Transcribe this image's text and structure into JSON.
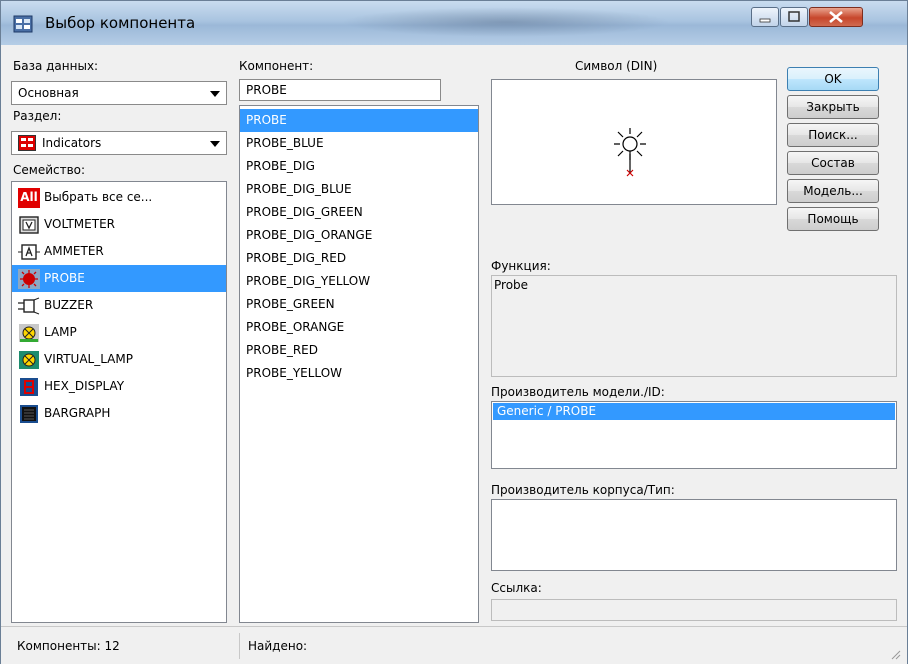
{
  "window": {
    "title": "Выбор компонента"
  },
  "database": {
    "label": "База данных:",
    "value": "Основная"
  },
  "section": {
    "label": "Раздел:",
    "value": "Indicators"
  },
  "family": {
    "label": "Семейство:",
    "items": [
      {
        "label": "Выбрать все се...",
        "icon": "all-icon"
      },
      {
        "label": "VOLTMETER",
        "icon": "voltmeter-icon"
      },
      {
        "label": "AMMETER",
        "icon": "ammeter-icon"
      },
      {
        "label": "PROBE",
        "icon": "probe-icon"
      },
      {
        "label": "BUZZER",
        "icon": "buzzer-icon"
      },
      {
        "label": "LAMP",
        "icon": "lamp-icon"
      },
      {
        "label": "VIRTUAL_LAMP",
        "icon": "virtual-lamp-icon"
      },
      {
        "label": "HEX_DISPLAY",
        "icon": "hex-display-icon"
      },
      {
        "label": "BARGRAPH",
        "icon": "bargraph-icon"
      }
    ],
    "selected": "PROBE",
    "all_badge": "All"
  },
  "component": {
    "label": "Компонент:",
    "value": "PROBE",
    "items": [
      "PROBE",
      "PROBE_BLUE",
      "PROBE_DIG",
      "PROBE_DIG_BLUE",
      "PROBE_DIG_GREEN",
      "PROBE_DIG_ORANGE",
      "PROBE_DIG_RED",
      "PROBE_DIG_YELLOW",
      "PROBE_GREEN",
      "PROBE_ORANGE",
      "PROBE_RED",
      "PROBE_YELLOW"
    ],
    "selected": "PROBE"
  },
  "symbol": {
    "label": "Символ (DIN)"
  },
  "function": {
    "label": "Функция:",
    "value": "Probe"
  },
  "model_manufacturer": {
    "label": "Производитель модели./ID:",
    "items": [
      "Generic / PROBE"
    ]
  },
  "package_manufacturer": {
    "label": "Производитель корпуса/Тип:"
  },
  "link": {
    "label": "Ссылка:",
    "value": ""
  },
  "buttons": {
    "ok": "OK",
    "close": "Закрыть",
    "search": "Поиск...",
    "detail": "Состав",
    "model": "Модель...",
    "help": "Помощь"
  },
  "status": {
    "components": "Компоненты: 12",
    "found": "Найдено:"
  },
  "colors": {
    "selection": "#3399ff",
    "all_badge": "#e00000",
    "probe_red": "#cc0000"
  }
}
